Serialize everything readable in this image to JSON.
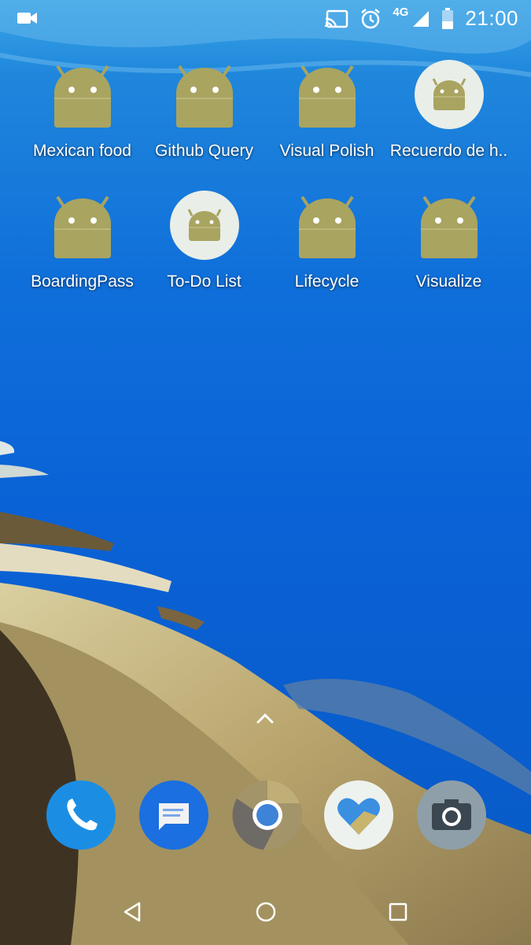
{
  "status_bar": {
    "time": "21:00",
    "network": "4G",
    "icons": [
      "video-camera-icon",
      "cast-icon",
      "alarm-icon",
      "signal-icon",
      "battery-icon"
    ]
  },
  "apps": [
    {
      "label": "Mexican food",
      "icon": "android-icon",
      "style": "plain"
    },
    {
      "label": "Github Query",
      "icon": "android-icon",
      "style": "plain"
    },
    {
      "label": "Visual Polish",
      "icon": "android-icon",
      "style": "plain"
    },
    {
      "label": "Recuerdo de h..",
      "icon": "android-icon",
      "style": "circle"
    },
    {
      "label": "BoardingPass",
      "icon": "android-icon",
      "style": "plain"
    },
    {
      "label": "To-Do List",
      "icon": "android-icon",
      "style": "circle"
    },
    {
      "label": "Lifecycle",
      "icon": "android-icon",
      "style": "plain"
    },
    {
      "label": "Visualize",
      "icon": "android-icon",
      "style": "plain"
    }
  ],
  "dock": [
    {
      "name": "phone-icon"
    },
    {
      "name": "messages-icon"
    },
    {
      "name": "chrome-icon"
    },
    {
      "name": "fit-heart-icon"
    },
    {
      "name": "camera-icon"
    }
  ],
  "nav": [
    "back-icon",
    "home-icon",
    "recents-icon"
  ],
  "colors": {
    "android_green": "#a9a460",
    "sea_blue": "#0a62d6",
    "icon_circle_bg": "#e9eee8"
  }
}
